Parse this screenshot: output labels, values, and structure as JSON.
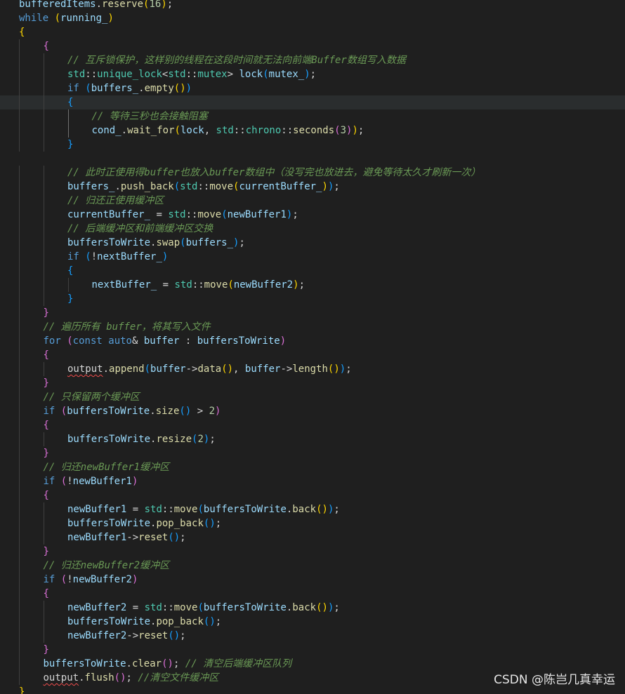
{
  "editor": {
    "lines": [
      {
        "indent": 0,
        "tokens": [
          [
            "var",
            "bufferedItems"
          ],
          [
            "pn",
            "."
          ],
          [
            "fn",
            "reserve"
          ],
          [
            "br1",
            "("
          ],
          [
            "num",
            "16"
          ],
          [
            "br1",
            ")"
          ],
          [
            "pn",
            ";"
          ]
        ]
      },
      {
        "indent": 0,
        "tokens": [
          [
            "kw",
            "while"
          ],
          [
            "pn",
            " "
          ],
          [
            "br1",
            "("
          ],
          [
            "var",
            "running_"
          ],
          [
            "br1",
            ")"
          ]
        ]
      },
      {
        "indent": 0,
        "tokens": [
          [
            "br1",
            "{"
          ]
        ]
      },
      {
        "indent": 1,
        "tokens": [
          [
            "br2",
            "{"
          ]
        ]
      },
      {
        "indent": 2,
        "tokens": [
          [
            "cm",
            "// 互斥锁保护，这样别的线程在这段时间就无法向前端Buffer数组写入数据"
          ]
        ]
      },
      {
        "indent": 2,
        "tokens": [
          [
            "tp",
            "std"
          ],
          [
            "pn",
            "::"
          ],
          [
            "tp",
            "unique_lock"
          ],
          [
            "pn",
            "<"
          ],
          [
            "tp",
            "std"
          ],
          [
            "pn",
            "::"
          ],
          [
            "tp",
            "mutex"
          ],
          [
            "pn",
            "> "
          ],
          [
            "var",
            "lock"
          ],
          [
            "br3",
            "("
          ],
          [
            "var",
            "mutex_"
          ],
          [
            "br3",
            ")"
          ],
          [
            "pn",
            ";"
          ]
        ]
      },
      {
        "indent": 2,
        "tokens": [
          [
            "kw",
            "if"
          ],
          [
            "pn",
            " "
          ],
          [
            "br3",
            "("
          ],
          [
            "var",
            "buffers_"
          ],
          [
            "pn",
            "."
          ],
          [
            "fn",
            "empty"
          ],
          [
            "br1",
            "()"
          ],
          [
            "br3",
            ")"
          ]
        ]
      },
      {
        "indent": 2,
        "current": true,
        "tokens": [
          [
            "br3",
            "{"
          ]
        ]
      },
      {
        "indent": 3,
        "tokens": [
          [
            "cm",
            "// 等待三秒也会接触阻塞"
          ]
        ]
      },
      {
        "indent": 3,
        "tokens": [
          [
            "var",
            "cond_"
          ],
          [
            "pn",
            "."
          ],
          [
            "fn",
            "wait_for"
          ],
          [
            "br1",
            "("
          ],
          [
            "var",
            "lock"
          ],
          [
            "pn",
            ", "
          ],
          [
            "tp",
            "std"
          ],
          [
            "pn",
            "::"
          ],
          [
            "tp",
            "chrono"
          ],
          [
            "pn",
            "::"
          ],
          [
            "fn",
            "seconds"
          ],
          [
            "br2",
            "("
          ],
          [
            "num",
            "3"
          ],
          [
            "br2",
            ")"
          ],
          [
            "br1",
            ")"
          ],
          [
            "pn",
            ";"
          ]
        ]
      },
      {
        "indent": 2,
        "tokens": [
          [
            "br3",
            "}"
          ]
        ]
      },
      {
        "indent": 0,
        "tokens": []
      },
      {
        "indent": 2,
        "tokens": [
          [
            "cm",
            "// 此时正使用得buffer也放入buffer数组中（没写完也放进去，避免等待太久才刷新一次）"
          ]
        ]
      },
      {
        "indent": 2,
        "tokens": [
          [
            "var",
            "buffers_"
          ],
          [
            "pn",
            "."
          ],
          [
            "fn",
            "push_back"
          ],
          [
            "br3",
            "("
          ],
          [
            "tp",
            "std"
          ],
          [
            "pn",
            "::"
          ],
          [
            "fn",
            "move"
          ],
          [
            "br1",
            "("
          ],
          [
            "var",
            "currentBuffer_"
          ],
          [
            "br1",
            ")"
          ],
          [
            "br3",
            ")"
          ],
          [
            "pn",
            ";"
          ]
        ]
      },
      {
        "indent": 2,
        "tokens": [
          [
            "cm",
            "// 归还正使用缓冲区"
          ]
        ]
      },
      {
        "indent": 2,
        "tokens": [
          [
            "var",
            "currentBuffer_"
          ],
          [
            "pn",
            " = "
          ],
          [
            "tp",
            "std"
          ],
          [
            "pn",
            "::"
          ],
          [
            "fn",
            "move"
          ],
          [
            "br3",
            "("
          ],
          [
            "var",
            "newBuffer1"
          ],
          [
            "br3",
            ")"
          ],
          [
            "pn",
            ";"
          ]
        ]
      },
      {
        "indent": 2,
        "tokens": [
          [
            "cm",
            "// 后端缓冲区和前端缓冲区交换"
          ]
        ]
      },
      {
        "indent": 2,
        "tokens": [
          [
            "var",
            "buffersToWrite"
          ],
          [
            "pn",
            "."
          ],
          [
            "fn",
            "swap"
          ],
          [
            "br3",
            "("
          ],
          [
            "var",
            "buffers_"
          ],
          [
            "br3",
            ")"
          ],
          [
            "pn",
            ";"
          ]
        ]
      },
      {
        "indent": 2,
        "tokens": [
          [
            "kw",
            "if"
          ],
          [
            "pn",
            " "
          ],
          [
            "br3",
            "("
          ],
          [
            "pn",
            "!"
          ],
          [
            "var",
            "nextBuffer_"
          ],
          [
            "br3",
            ")"
          ]
        ]
      },
      {
        "indent": 2,
        "tokens": [
          [
            "br3",
            "{"
          ]
        ]
      },
      {
        "indent": 3,
        "tokens": [
          [
            "var",
            "nextBuffer_"
          ],
          [
            "pn",
            " = "
          ],
          [
            "tp",
            "std"
          ],
          [
            "pn",
            "::"
          ],
          [
            "fn",
            "move"
          ],
          [
            "br1",
            "("
          ],
          [
            "var",
            "newBuffer2"
          ],
          [
            "br1",
            ")"
          ],
          [
            "pn",
            ";"
          ]
        ]
      },
      {
        "indent": 2,
        "tokens": [
          [
            "br3",
            "}"
          ]
        ]
      },
      {
        "indent": 1,
        "tokens": [
          [
            "br2",
            "}"
          ]
        ]
      },
      {
        "indent": 1,
        "tokens": [
          [
            "cm",
            "// 遍历所有 buffer，将其写入文件"
          ]
        ]
      },
      {
        "indent": 1,
        "tokens": [
          [
            "kw",
            "for"
          ],
          [
            "pn",
            " "
          ],
          [
            "br2",
            "("
          ],
          [
            "kw",
            "const"
          ],
          [
            "pn",
            " "
          ],
          [
            "kw",
            "auto"
          ],
          [
            "pn",
            "& "
          ],
          [
            "var",
            "buffer"
          ],
          [
            "pn",
            " : "
          ],
          [
            "var",
            "buffersToWrite"
          ],
          [
            "br2",
            ")"
          ]
        ]
      },
      {
        "indent": 1,
        "tokens": [
          [
            "br2",
            "{"
          ]
        ]
      },
      {
        "indent": 2,
        "tokens": [
          [
            "err",
            "output"
          ],
          [
            "pn",
            "."
          ],
          [
            "fn",
            "append"
          ],
          [
            "br3",
            "("
          ],
          [
            "var",
            "buffer"
          ],
          [
            "pn",
            "->"
          ],
          [
            "fn",
            "data"
          ],
          [
            "br1",
            "()"
          ],
          [
            "pn",
            ", "
          ],
          [
            "var",
            "buffer"
          ],
          [
            "pn",
            "->"
          ],
          [
            "fn",
            "length"
          ],
          [
            "br1",
            "()"
          ],
          [
            "br3",
            ")"
          ],
          [
            "pn",
            ";"
          ]
        ]
      },
      {
        "indent": 1,
        "tokens": [
          [
            "br2",
            "}"
          ]
        ]
      },
      {
        "indent": 1,
        "tokens": [
          [
            "cm",
            "// 只保留两个缓冲区"
          ]
        ]
      },
      {
        "indent": 1,
        "tokens": [
          [
            "kw",
            "if"
          ],
          [
            "pn",
            " "
          ],
          [
            "br2",
            "("
          ],
          [
            "var",
            "buffersToWrite"
          ],
          [
            "pn",
            "."
          ],
          [
            "fn",
            "size"
          ],
          [
            "br3",
            "()"
          ],
          [
            "pn",
            " > "
          ],
          [
            "num",
            "2"
          ],
          [
            "br2",
            ")"
          ]
        ]
      },
      {
        "indent": 1,
        "tokens": [
          [
            "br2",
            "{"
          ]
        ]
      },
      {
        "indent": 2,
        "tokens": [
          [
            "var",
            "buffersToWrite"
          ],
          [
            "pn",
            "."
          ],
          [
            "fn",
            "resize"
          ],
          [
            "br3",
            "("
          ],
          [
            "num",
            "2"
          ],
          [
            "br3",
            ")"
          ],
          [
            "pn",
            ";"
          ]
        ]
      },
      {
        "indent": 1,
        "tokens": [
          [
            "br2",
            "}"
          ]
        ]
      },
      {
        "indent": 1,
        "tokens": [
          [
            "cm",
            "// 归还newBuffer1缓冲区"
          ]
        ]
      },
      {
        "indent": 1,
        "tokens": [
          [
            "kw",
            "if"
          ],
          [
            "pn",
            " "
          ],
          [
            "br2",
            "("
          ],
          [
            "pn",
            "!"
          ],
          [
            "var",
            "newBuffer1"
          ],
          [
            "br2",
            ")"
          ]
        ]
      },
      {
        "indent": 1,
        "tokens": [
          [
            "br2",
            "{"
          ]
        ]
      },
      {
        "indent": 2,
        "tokens": [
          [
            "var",
            "newBuffer1"
          ],
          [
            "pn",
            " = "
          ],
          [
            "tp",
            "std"
          ],
          [
            "pn",
            "::"
          ],
          [
            "fn",
            "move"
          ],
          [
            "br3",
            "("
          ],
          [
            "var",
            "buffersToWrite"
          ],
          [
            "pn",
            "."
          ],
          [
            "fn",
            "back"
          ],
          [
            "br1",
            "()"
          ],
          [
            "br3",
            ")"
          ],
          [
            "pn",
            ";"
          ]
        ]
      },
      {
        "indent": 2,
        "tokens": [
          [
            "var",
            "buffersToWrite"
          ],
          [
            "pn",
            "."
          ],
          [
            "fn",
            "pop_back"
          ],
          [
            "br3",
            "()"
          ],
          [
            "pn",
            ";"
          ]
        ]
      },
      {
        "indent": 2,
        "tokens": [
          [
            "var",
            "newBuffer1"
          ],
          [
            "pn",
            "->"
          ],
          [
            "fn",
            "reset"
          ],
          [
            "br3",
            "()"
          ],
          [
            "pn",
            ";"
          ]
        ]
      },
      {
        "indent": 1,
        "tokens": [
          [
            "br2",
            "}"
          ]
        ]
      },
      {
        "indent": 1,
        "tokens": [
          [
            "cm",
            "// 归还newBuffer2缓冲区"
          ]
        ]
      },
      {
        "indent": 1,
        "tokens": [
          [
            "kw",
            "if"
          ],
          [
            "pn",
            " "
          ],
          [
            "br2",
            "("
          ],
          [
            "pn",
            "!"
          ],
          [
            "var",
            "newBuffer2"
          ],
          [
            "br2",
            ")"
          ]
        ]
      },
      {
        "indent": 1,
        "tokens": [
          [
            "br2",
            "{"
          ]
        ]
      },
      {
        "indent": 2,
        "tokens": [
          [
            "var",
            "newBuffer2"
          ],
          [
            "pn",
            " = "
          ],
          [
            "tp",
            "std"
          ],
          [
            "pn",
            "::"
          ],
          [
            "fn",
            "move"
          ],
          [
            "br3",
            "("
          ],
          [
            "var",
            "buffersToWrite"
          ],
          [
            "pn",
            "."
          ],
          [
            "fn",
            "back"
          ],
          [
            "br1",
            "()"
          ],
          [
            "br3",
            ")"
          ],
          [
            "pn",
            ";"
          ]
        ]
      },
      {
        "indent": 2,
        "tokens": [
          [
            "var",
            "buffersToWrite"
          ],
          [
            "pn",
            "."
          ],
          [
            "fn",
            "pop_back"
          ],
          [
            "br3",
            "()"
          ],
          [
            "pn",
            ";"
          ]
        ]
      },
      {
        "indent": 2,
        "tokens": [
          [
            "var",
            "newBuffer2"
          ],
          [
            "pn",
            "->"
          ],
          [
            "fn",
            "reset"
          ],
          [
            "br3",
            "()"
          ],
          [
            "pn",
            ";"
          ]
        ]
      },
      {
        "indent": 1,
        "tokens": [
          [
            "br2",
            "}"
          ]
        ]
      },
      {
        "indent": 1,
        "tokens": [
          [
            "var",
            "buffersToWrite"
          ],
          [
            "pn",
            "."
          ],
          [
            "fn",
            "clear"
          ],
          [
            "br2",
            "()"
          ],
          [
            "pn",
            "; "
          ],
          [
            "cm",
            "// 清空后端缓冲区队列"
          ]
        ]
      },
      {
        "indent": 1,
        "tokens": [
          [
            "err",
            "output"
          ],
          [
            "pn",
            "."
          ],
          [
            "fn",
            "flush"
          ],
          [
            "br2",
            "()"
          ],
          [
            "pn",
            "; "
          ],
          [
            "cm",
            "//清空文件缓冲区"
          ]
        ]
      },
      {
        "indent": 0,
        "tokens": [
          [
            "br1",
            "}"
          ]
        ]
      }
    ]
  },
  "watermark": {
    "text": "CSDN @陈岂几真幸运"
  },
  "colors": {
    "background": "#1f1f1f",
    "keyword": "#569cd6",
    "type": "#4ec9b0",
    "function": "#dcdcaa",
    "variable": "#9cdcfe",
    "number": "#b5cea8",
    "comment": "#6a9955",
    "bracket_level1": "#ffd700",
    "bracket_level2": "#da70d6",
    "bracket_level3": "#179fff",
    "error_squiggle": "#f14c4c"
  }
}
